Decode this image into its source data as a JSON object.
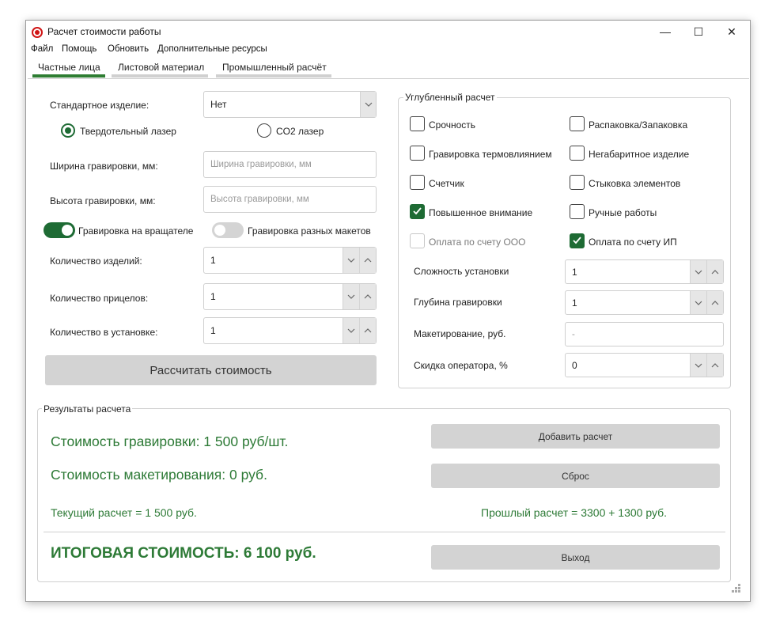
{
  "window": {
    "title": "Расчет стоимости работы",
    "minimize": "—",
    "maximize": "☐",
    "close": "✕"
  },
  "menu": [
    "Файл",
    "Помощь",
    "Обновить",
    "Дополнительные ресурсы"
  ],
  "tabs": [
    {
      "label": "Частные лица",
      "active": true
    },
    {
      "label": "Листовой материал",
      "active": false
    },
    {
      "label": "Промышленный расчёт",
      "active": false
    }
  ],
  "left": {
    "standard_product_label": "Стандартное изделие:",
    "standard_product_value": "Нет",
    "radio_solid_state": "Твердотельный лазер",
    "radio_co2": "CO2 лазер",
    "width_label": "Ширина гравировки, мм:",
    "width_placeholder": "Ширина гравировки, мм",
    "height_label": "Высота гравировки, мм:",
    "height_placeholder": "Высота гравировки, мм",
    "toggle_rotator": "Гравировка на вращателе",
    "toggle_layouts": "Гравировка разных макетов",
    "qty_items_label": "Количество изделий:",
    "qty_items_value": "1",
    "qty_sights_label": "Количество прицелов:",
    "qty_sights_value": "1",
    "qty_setup_label": "Количество в установке:",
    "qty_setup_value": "1",
    "calc_button": "Рассчитать стоимость"
  },
  "advanced": {
    "title": "Углубленный расчет",
    "checkboxes": [
      {
        "label": "Срочность",
        "checked": false,
        "disabled": false
      },
      {
        "label": "Распаковка/Запаковка",
        "checked": false,
        "disabled": false
      },
      {
        "label": "Гравировка термовлиянием",
        "checked": false,
        "disabled": false
      },
      {
        "label": "Негабаритное изделие",
        "checked": false,
        "disabled": false
      },
      {
        "label": "Счетчик",
        "checked": false,
        "disabled": false
      },
      {
        "label": "Стыковка элементов",
        "checked": false,
        "disabled": false
      },
      {
        "label": "Повышенное внимание",
        "checked": true,
        "disabled": false
      },
      {
        "label": "Ручные работы",
        "checked": false,
        "disabled": false
      },
      {
        "label": "Оплата по счету ООО",
        "checked": false,
        "disabled": true
      },
      {
        "label": "Оплата по счету ИП",
        "checked": true,
        "disabled": false
      }
    ],
    "complexity_label": "Сложность установки",
    "complexity_value": "1",
    "depth_label": "Глубина гравировки",
    "depth_value": "1",
    "layout_label": "Макетирование, руб.",
    "layout_value": "-",
    "discount_label": "Скидка оператора, %",
    "discount_value": "0"
  },
  "results": {
    "title": "Результаты расчета",
    "engraving_cost": "Стоимость гравировки:  1 500  руб/шт.",
    "layout_cost": "Стоимость макетирования:  0  руб.",
    "current_calc": "Текущий расчет = 1 500 руб.",
    "previous_calc": "Прошлый расчет = 3300 + 1300 руб.",
    "total": "ИТОГОВАЯ СТОИМОСТЬ:  6 100  руб.",
    "add_button": "Добавить расчет",
    "reset_button": "Сброс",
    "exit_button": "Выход"
  },
  "colors": {
    "accent": "#1e6b34",
    "result_text": "#2d7a36",
    "button_bg": "#d3d3d3"
  },
  "icons": [
    "app-icon",
    "chevron-down-icon",
    "chevron-up-icon",
    "check-icon",
    "resize-grip-icon"
  ]
}
